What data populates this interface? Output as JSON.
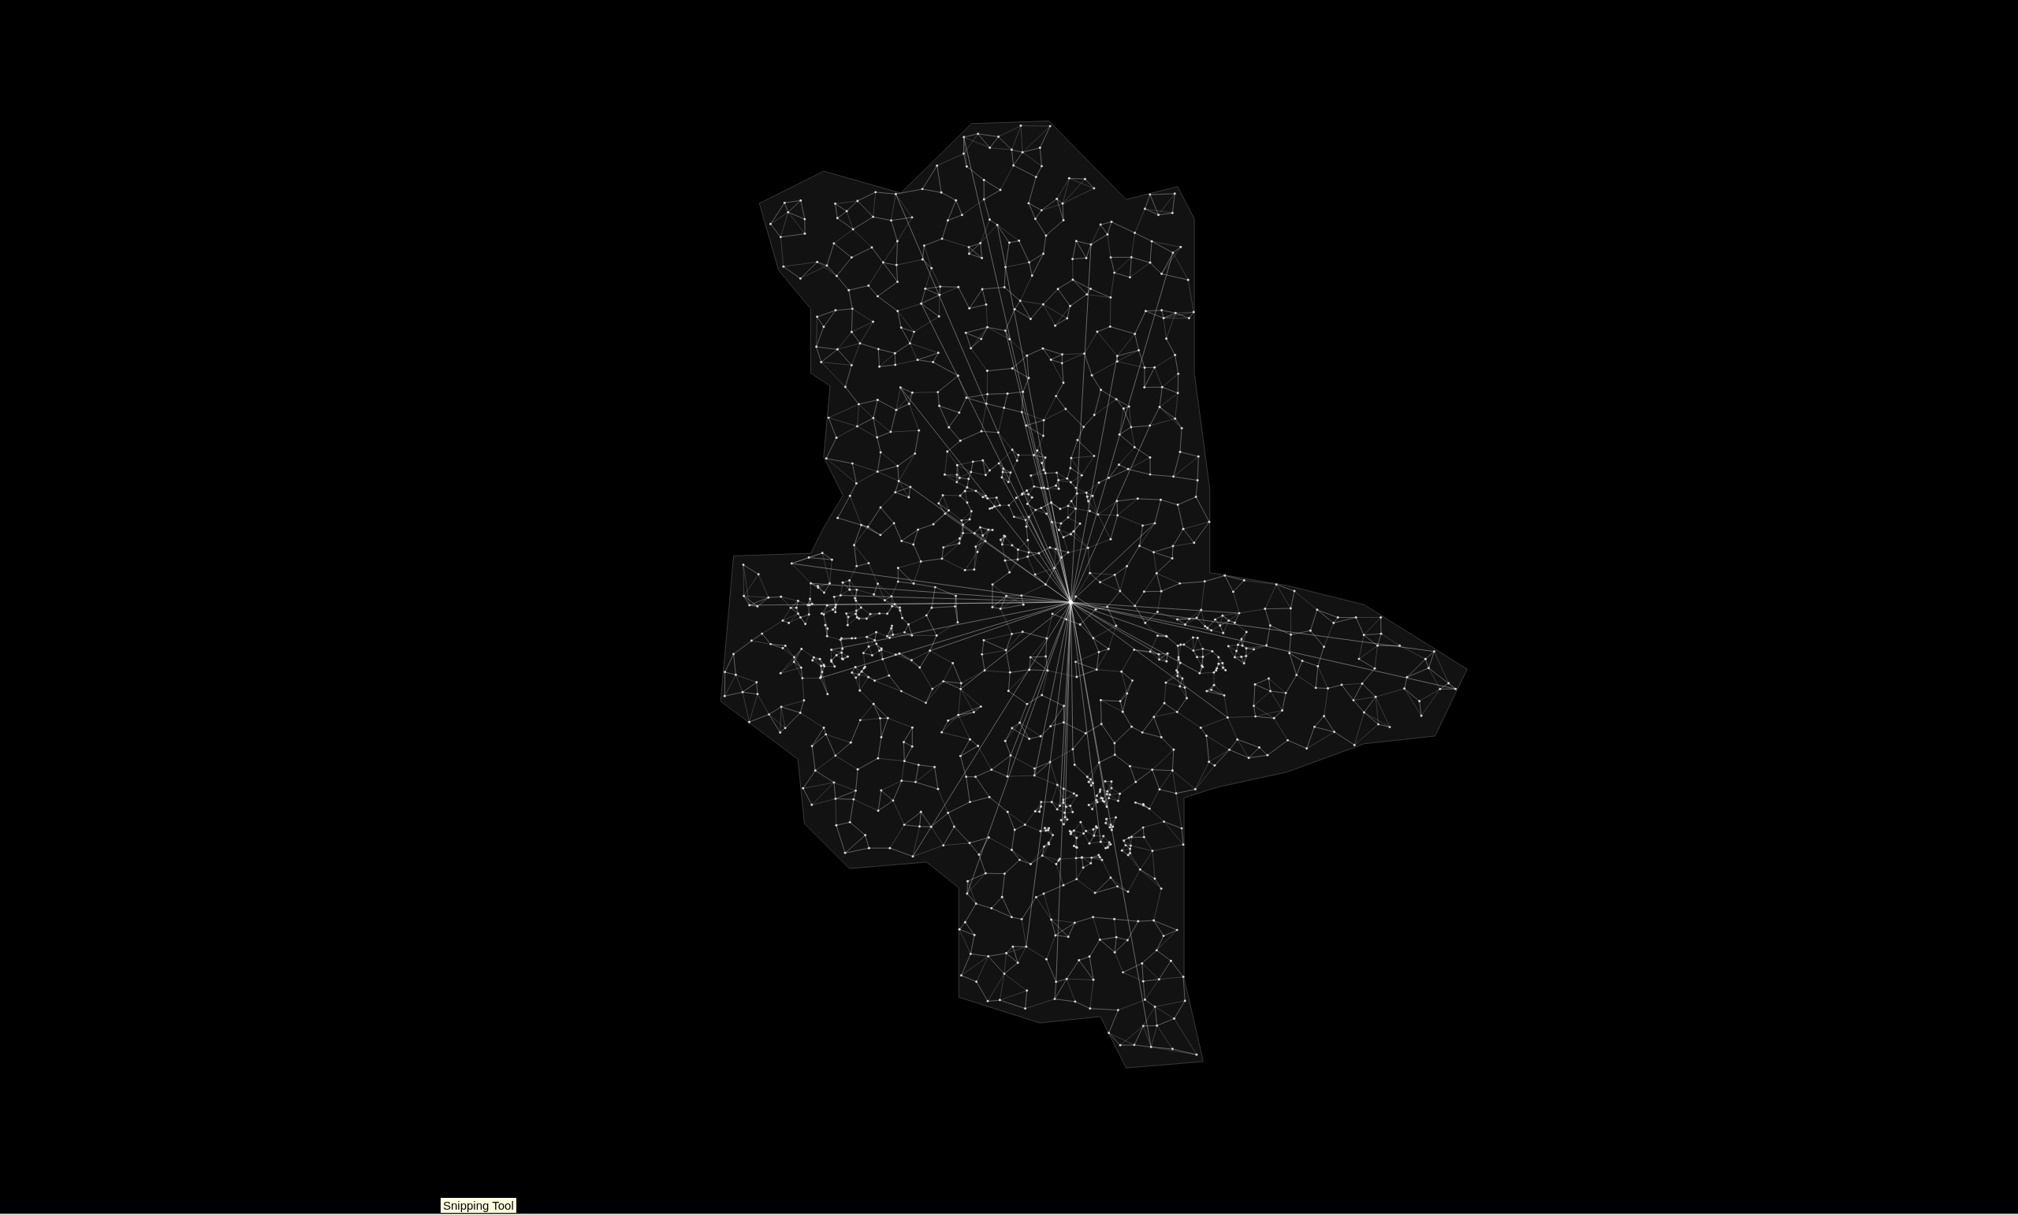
{
  "tooltip": {
    "text": "Snipping Tool"
  }
}
